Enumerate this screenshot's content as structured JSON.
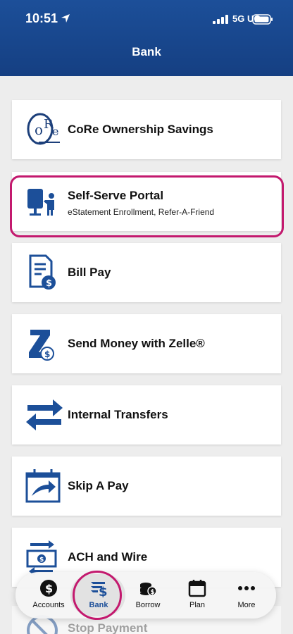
{
  "status_bar": {
    "time": "10:51",
    "network": "5G UC"
  },
  "header": {
    "title": "Bank"
  },
  "menu_items": [
    {
      "title": "CoRe Ownership Savings",
      "subtitle": "",
      "icon": "core-logo-icon"
    },
    {
      "title": "Self-Serve Portal",
      "subtitle": "eStatement Enrollment, Refer-A-Friend",
      "icon": "presentation-icon"
    },
    {
      "title": "Bill Pay",
      "subtitle": "",
      "icon": "bill-icon"
    },
    {
      "title": "Send Money with Zelle®",
      "subtitle": "",
      "icon": "zelle-icon"
    },
    {
      "title": "Internal Transfers",
      "subtitle": "",
      "icon": "transfer-arrows-icon"
    },
    {
      "title": "Skip A Pay",
      "subtitle": "",
      "icon": "calendar-arrow-icon"
    },
    {
      "title": "ACH and Wire",
      "subtitle": "",
      "icon": "ach-wire-icon"
    },
    {
      "title": "Stop Payment",
      "subtitle": "",
      "icon": "stop-icon"
    }
  ],
  "tabbar": {
    "tabs": [
      {
        "label": "Accounts",
        "icon": "dollar-circle-icon"
      },
      {
        "label": "Bank",
        "icon": "bank-dollar-icon",
        "active": true
      },
      {
        "label": "Borrow",
        "icon": "coins-icon"
      },
      {
        "label": "Plan",
        "icon": "calendar-icon"
      },
      {
        "label": "More",
        "icon": "more-dots-icon"
      }
    ]
  },
  "colors": {
    "brand_blue": "#1c4f99",
    "highlight": "#c3196e"
  }
}
